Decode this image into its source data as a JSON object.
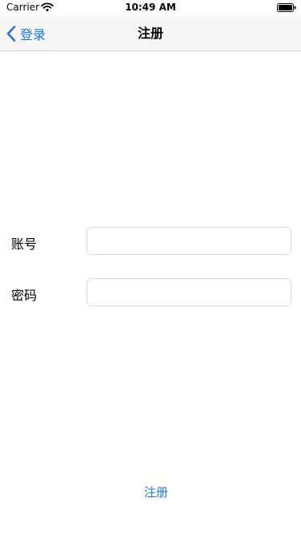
{
  "status_bar": {
    "carrier": "Carrier",
    "time": "10:49 AM",
    "wifi_icon": "wifi-icon",
    "battery_icon": "battery-icon"
  },
  "nav_bar": {
    "back_label": "登录",
    "back_icon": "chevron-left-icon",
    "title": "注册"
  },
  "form": {
    "account_label": "账号",
    "account_value": "",
    "account_placeholder": "",
    "password_label": "密码",
    "password_value": "",
    "password_placeholder": ""
  },
  "register_button_label": "注册",
  "colors": {
    "accent": "#1f74e6",
    "nav_background": "#f7f7f7",
    "field_border": "#d9d9dd"
  }
}
